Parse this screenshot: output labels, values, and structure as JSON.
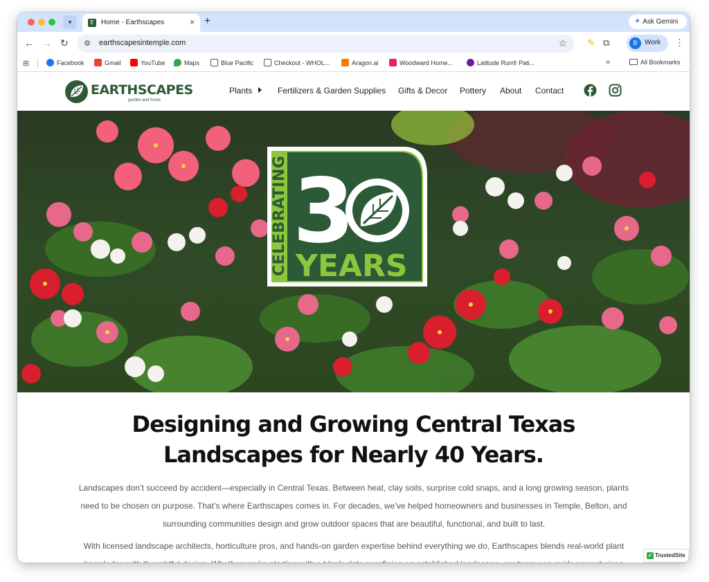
{
  "browser": {
    "tab_title": "Home - Earthscapes",
    "tab_close": "×",
    "new_tab": "+",
    "gemini_label": "Ask Gemini",
    "url": "earthscapesintemple.com",
    "profile_initial": "B",
    "profile_label": "Work",
    "bookmarks": [
      {
        "label": "Facebook",
        "color": "#1877f2"
      },
      {
        "label": "Gmail",
        "color": "#ea4335"
      },
      {
        "label": "YouTube",
        "color": "#ff0000"
      },
      {
        "label": "Maps",
        "color": "#34a853"
      },
      {
        "label": "Blue Pacific",
        "color": "#555555"
      },
      {
        "label": "Checkout - WHOL...",
        "color": "#555555"
      },
      {
        "label": "Aragon.ai",
        "color": "#f57c00"
      },
      {
        "label": "Woodward Home...",
        "color": "#e91e63"
      },
      {
        "label": "Latitude Run® Pati...",
        "color": "#6a1b9a"
      }
    ],
    "all_bookmarks": "All Bookmarks"
  },
  "site": {
    "logo_name": "EARTHSCAPES",
    "logo_tagline": "garden and home",
    "nav": {
      "plants": "Plants",
      "fertilizers": "Fertilizers & Garden Supplies",
      "gifts": "Gifts & Decor",
      "pottery": "Pottery",
      "about": "About",
      "contact": "Contact"
    },
    "badge": {
      "celebrating": "CELEBRATING",
      "number_digit": "3",
      "years": "YEARS"
    },
    "headline_line1": "Designing and Growing Central Texas",
    "headline_line2": "Landscapes for Nearly 40 Years.",
    "para1_lines": [
      "Landscapes don’t succeed by accident—especially in Central Texas. Between heat, clay soils, surprise cold snaps, and a long growing season, plants",
      "need to be chosen on purpose. That’s where Earthscapes comes in. For decades, we’ve helped homeowners and businesses in Temple, Belton, and",
      "surrounding communities design and grow outdoor spaces that are beautiful, functional, and built to last."
    ],
    "para2_lines": [
      "With licensed landscape architects, horticulture pros, and hands-on garden expertise behind everything we do, Earthscapes blends real-world plant",
      "knowledge with thoughtful design. Whether you’re starting with a blank slate or refining an established landscape, our team can guide your choices"
    ],
    "trusted_site": "TrustedSite"
  },
  "colors": {
    "brand_green": "#2d5a36",
    "badge_lime": "#8cc63f"
  }
}
